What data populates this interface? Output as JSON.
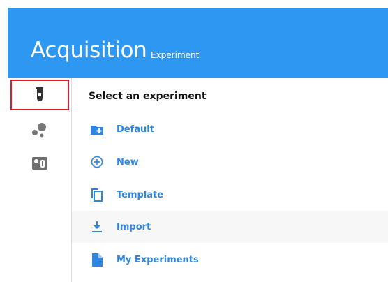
{
  "header": {
    "title": "Acquisition",
    "subtitle": "Experiment"
  },
  "sidebar": {
    "items": [
      {
        "icon": "test-tube-icon",
        "selected": true
      },
      {
        "icon": "bubbles-icon",
        "selected": false
      },
      {
        "icon": "instrument-icon",
        "selected": false
      }
    ]
  },
  "main": {
    "heading": "Select an experiment",
    "items": [
      {
        "label": "Default",
        "icon": "folder-plus-icon"
      },
      {
        "label": "New",
        "icon": "add-circle-icon"
      },
      {
        "label": "Template",
        "icon": "copy-icon"
      },
      {
        "label": "Import",
        "icon": "download-icon"
      },
      {
        "label": "My Experiments",
        "icon": "document-icon"
      }
    ]
  },
  "colors": {
    "header_bg": "#2e97f2",
    "accent": "#2e86de",
    "selection_border": "#e21b24"
  }
}
